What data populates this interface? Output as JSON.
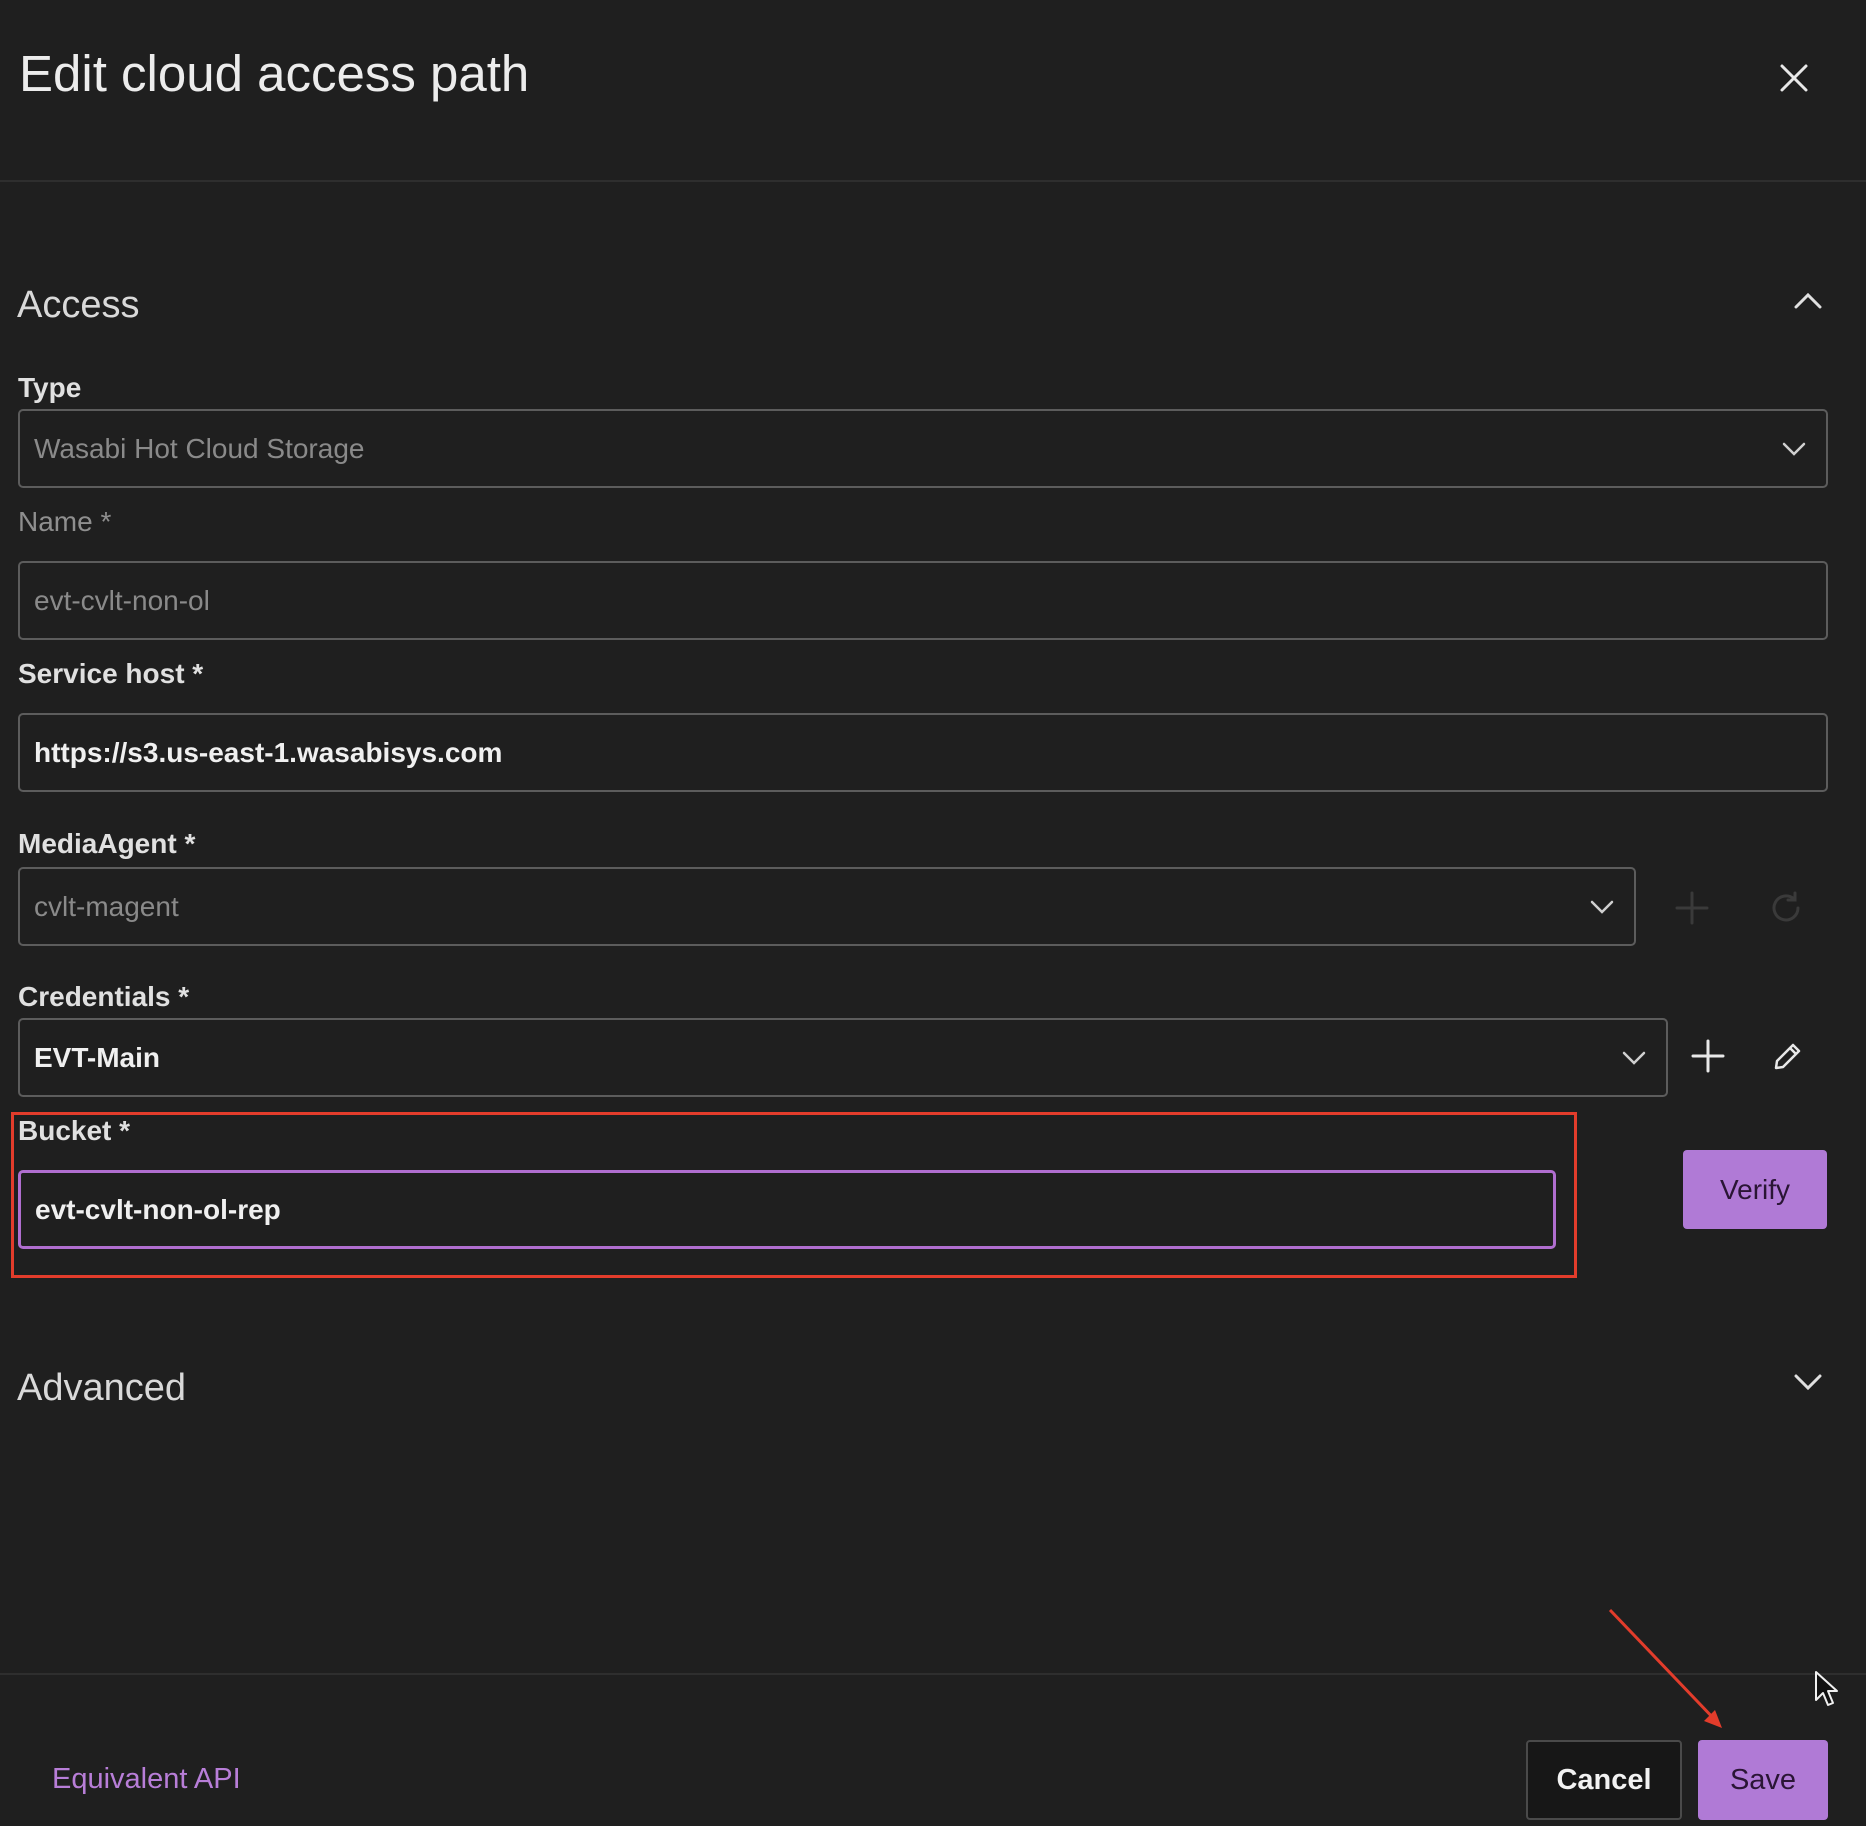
{
  "dialog": {
    "title": "Edit cloud access path",
    "close_icon": "close-icon"
  },
  "access": {
    "title": "Access",
    "state": "expanded",
    "type": {
      "label": "Type",
      "value": "Wasabi Hot Cloud Storage"
    },
    "name": {
      "label": "Name *",
      "value": "evt-cvlt-non-ol"
    },
    "service_host": {
      "label": "Service host *",
      "value": "https://s3.us-east-1.wasabisys.com"
    },
    "media_agent": {
      "label": "MediaAgent *",
      "value": "cvlt-magent"
    },
    "credentials": {
      "label": "Credentials *",
      "value": "EVT-Main"
    },
    "bucket": {
      "label": "Bucket *",
      "value": "evt-cvlt-non-ol-rep"
    },
    "verify_label": "Verify"
  },
  "advanced": {
    "title": "Advanced",
    "state": "collapsed"
  },
  "footer": {
    "equivalent_api": "Equivalent API",
    "cancel": "Cancel",
    "save": "Save"
  },
  "colors": {
    "background": "#1f1f1f",
    "accent": "#b07ad6",
    "highlight_annotation": "#e23c2b"
  }
}
